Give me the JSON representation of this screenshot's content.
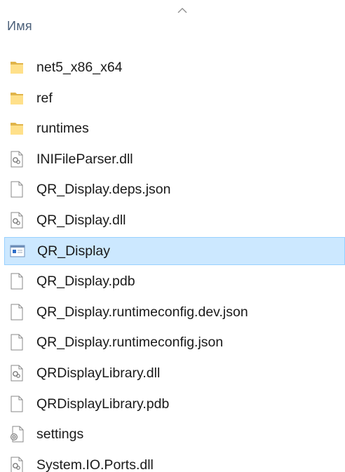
{
  "header": {
    "column_name": "Имя",
    "sort_icon": "sort-ascending-chevron-icon"
  },
  "files": [
    {
      "name": "net5_x86_x64",
      "icon": "folder-icon",
      "selected": false
    },
    {
      "name": "ref",
      "icon": "folder-icon",
      "selected": false
    },
    {
      "name": "runtimes",
      "icon": "folder-icon",
      "selected": false
    },
    {
      "name": "INIFileParser.dll",
      "icon": "dll-file-icon",
      "selected": false
    },
    {
      "name": "QR_Display.deps.json",
      "icon": "blank-file-icon",
      "selected": false
    },
    {
      "name": "QR_Display.dll",
      "icon": "dll-file-icon",
      "selected": false
    },
    {
      "name": "QR_Display",
      "icon": "application-icon",
      "selected": true
    },
    {
      "name": "QR_Display.pdb",
      "icon": "blank-file-icon",
      "selected": false
    },
    {
      "name": "QR_Display.runtimeconfig.dev.json",
      "icon": "blank-file-icon",
      "selected": false
    },
    {
      "name": "QR_Display.runtimeconfig.json",
      "icon": "blank-file-icon",
      "selected": false
    },
    {
      "name": "QRDisplayLibrary.dll",
      "icon": "dll-file-icon",
      "selected": false
    },
    {
      "name": "QRDisplayLibrary.pdb",
      "icon": "blank-file-icon",
      "selected": false
    },
    {
      "name": "settings",
      "icon": "settings-file-icon",
      "selected": false
    },
    {
      "name": "System.IO.Ports.dll",
      "icon": "dll-file-icon",
      "selected": false
    }
  ],
  "colors": {
    "selection_fill": "#cce8ff",
    "selection_border": "#99d1ff",
    "folder": "#f8d775",
    "header_text": "#4c607a"
  }
}
